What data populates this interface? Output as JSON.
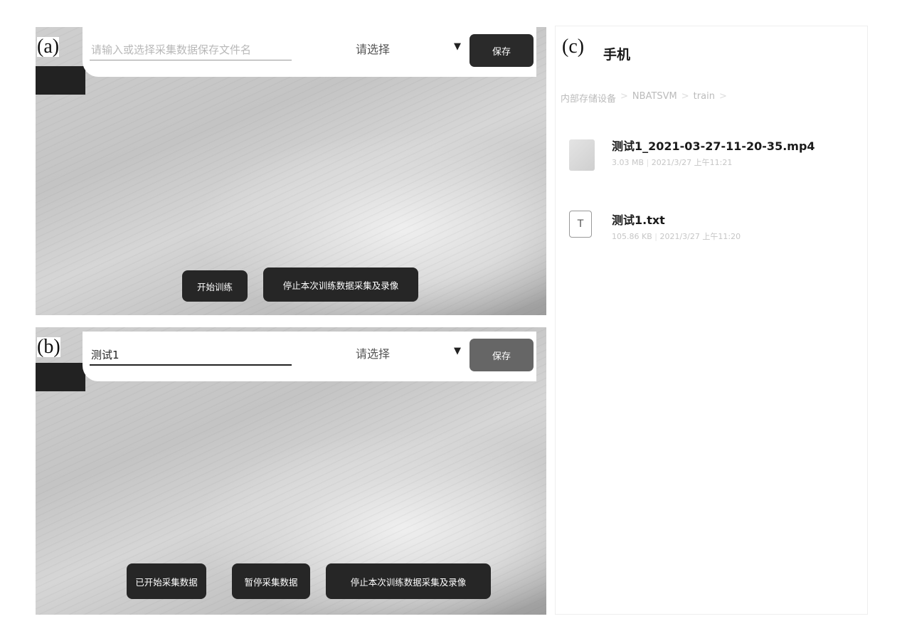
{
  "panels": {
    "a": {
      "label": "(a)",
      "filename_placeholder": "请输入或选择采集数据保存文件名",
      "select_label": "请选择",
      "select_caret": "▼",
      "save_label": "保存",
      "buttons": [
        "开始训练",
        "停止本次训练数据采集及录像"
      ]
    },
    "b": {
      "label": "(b)",
      "filename_value": "测试1",
      "select_label": "请选择",
      "select_caret": "▼",
      "save_label": "保存",
      "buttons": [
        "已开始采集数据",
        "暂停采集数据",
        "停止本次训练数据采集及录像"
      ]
    },
    "c": {
      "label": "(c)",
      "title": "手机",
      "breadcrumb": [
        "内部存储设备",
        "NBATSVM",
        "train"
      ],
      "breadcrumb_sep": ">",
      "files": [
        {
          "name": "测试1_2021-03-27-11-20-35.mp4",
          "size": "3.03 MB",
          "date": "2021/3/27 上午11:21",
          "icon": "video-thumbnail-icon"
        },
        {
          "name": "测试1.txt",
          "size": "105.86 KB",
          "date": "2021/3/27 上午11:20",
          "icon": "text-file-icon",
          "icon_glyph": "T"
        }
      ],
      "meta_sep": "|"
    }
  },
  "colors": {
    "button_dark": "#262626",
    "save_active": "#2a2a2a",
    "save_disabled": "#666666"
  }
}
